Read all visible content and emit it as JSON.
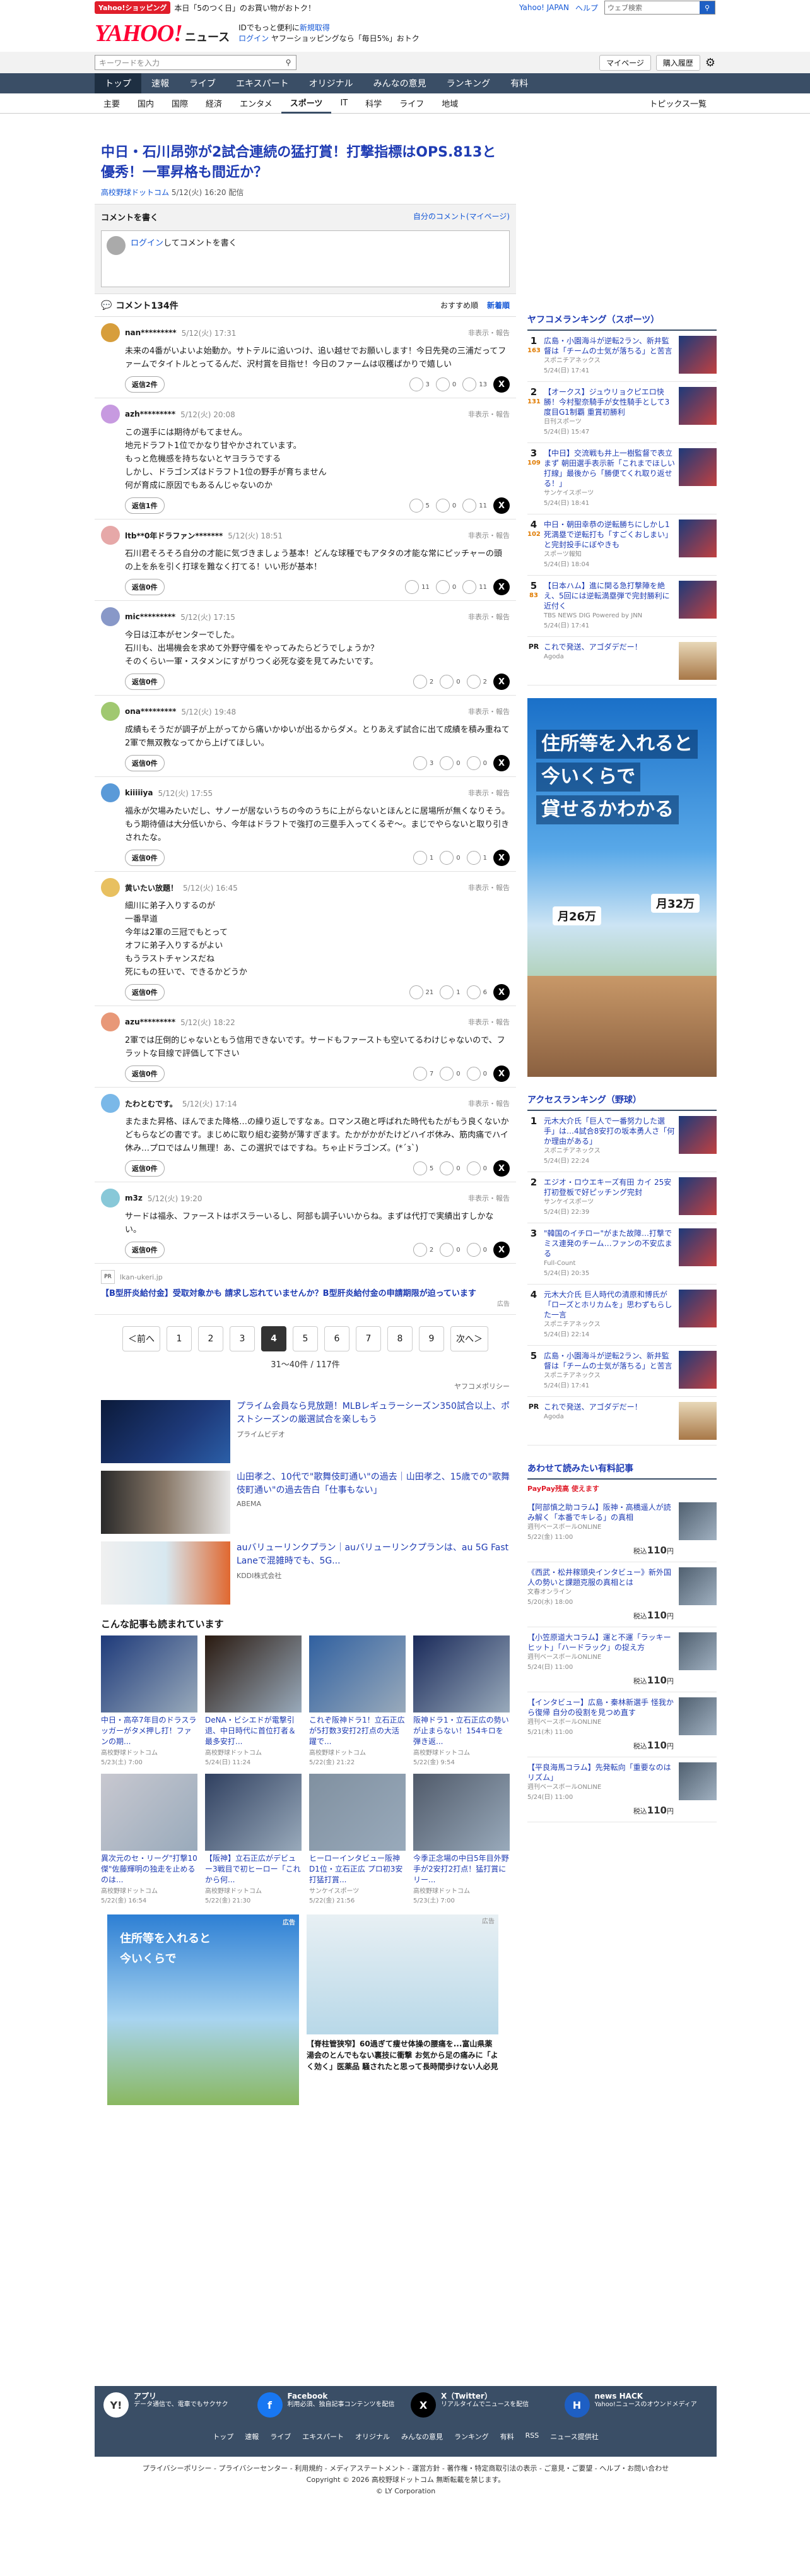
{
  "promo": {
    "badge": "Yahoo!ショッピング",
    "text": "本日「5のつく日」のお買い物がおトク！"
  },
  "topbar": {
    "links": [
      "Yahoo! JAPAN",
      "ヘルプ"
    ],
    "search_placeholder": "ウェブ検索",
    "search_label": "検索"
  },
  "header": {
    "logo": "YAHOO!",
    "logo_sub": "JAPAN",
    "service": "ニュース",
    "line1a": "IDでもっと便利に",
    "line1b": "新規取得",
    "line2a": "ログイン",
    "line2b": "ヤフーショッピングなら「毎日5%」おトク"
  },
  "search": {
    "placeholder": "キーワードを入力",
    "mypage": "マイページ",
    "purchase": "購入履歴"
  },
  "nav": [
    "トップ",
    "速報",
    "ライブ",
    "エキスパート",
    "オリジナル",
    "みんなの意見",
    "ランキング",
    "有料"
  ],
  "subnav": [
    "主要",
    "国内",
    "国際",
    "経済",
    "エンタメ",
    "スポーツ",
    "IT",
    "科学",
    "ライフ",
    "地域"
  ],
  "subnav_more": "トピックス一覧",
  "article": {
    "title": "中日・石川昂弥が2試合連続の猛打賞！打撃指標はOPS.813と優秀！一軍昇格も間近か？",
    "source": "高校野球ドットコム",
    "date": "5/12(火) 16:20",
    "status": "配信"
  },
  "comment_box": {
    "title": "コメントを書く",
    "my_comments": "自分のコメント(マイページ)",
    "login": "ログイン",
    "placeholder": "してコメントを書く"
  },
  "comment_list": {
    "title": "コメント134件",
    "sort_recommend": "おすすめ順",
    "sort_new": "新着順"
  },
  "comments": [
    {
      "user": "nan*********",
      "time": "5/12(火) 17:31",
      "report": "非表示・報告",
      "body": "未来の4番がいよいよ始動か。サトテルに追いつけ、追い越せでお願いします！今日先発の三浦だってファームでタイトルとってるんだ、沢村賞を目指せ！今日のファームは収穫ばかりで嬉しい",
      "reply": "返信2件",
      "r1": "3",
      "r2": "0",
      "r3": "13",
      "color": "#d79e3c"
    },
    {
      "user": "azh*********",
      "time": "5/12(火) 20:08",
      "report": "非表示・報告",
      "body": "この選手には期待がもてません。\n地元ドラフト1位でかなり甘やかされています。\nもっと危機感を持ちないとヤヨラうでする\nしかし、ドラゴンズはドラフト1位の野手が育ちません\n何が育成に原因でもあるんじゃないのか",
      "reply": "返信1件",
      "r1": "5",
      "r2": "0",
      "r3": "11",
      "color": "#c79ae0"
    },
    {
      "user": "ltb**0年ドラファン*******",
      "time": "5/12(火) 18:51",
      "report": "非表示・報告",
      "body": "石川君そろそろ自分の才能に気づきましょう基本！どんな球種でもアタタの才能な常にピッチャーの頭の上を糸を引く打球を難なく打てる！いい形が基本！",
      "reply": "返信0件",
      "r1": "11",
      "r2": "0",
      "r3": "11",
      "color": "#e6a8a8"
    },
    {
      "user": "mic*********",
      "time": "5/12(火) 17:15",
      "report": "非表示・報告",
      "body": "今日は江本がセンターでした。\n石川も、出場機会を求めて外野守備をやってみたらどうでしょうか？\nそのくらい一軍・スタメンにすがりつく必死な姿を見てみたいです。",
      "reply": "返信0件",
      "r1": "2",
      "r2": "0",
      "r3": "2",
      "color": "#8898c8"
    },
    {
      "user": "ona*********",
      "time": "5/12(火) 19:48",
      "report": "非表示・報告",
      "body": "成績もそうだが調子が上がってから痛いかゆいが出るからダメ。とりあえず試合に出て成績を積み重ねて2軍で無双教なってから上げてほしい。",
      "reply": "返信0件",
      "r1": "3",
      "r2": "0",
      "r3": "0",
      "color": "#a0c870"
    },
    {
      "user": "kiiiiiya",
      "time": "5/12(火) 17:55",
      "report": "非表示・報告",
      "body": "福永が欠場みたいだし、サノーが居ないうちの今のうちに上がらないとほんとに居場所が無くなりそう。\nもう期待値は大分低いから、今年はドラフトで強打の三塁手入ってくるぞ～。まじでやらないと取り引きされたな。",
      "reply": "返信0件",
      "r1": "1",
      "r2": "0",
      "r3": "1",
      "color": "#5a9ad8"
    },
    {
      "user": "黄いたい放題！",
      "time": "5/12(火) 16:45",
      "report": "非表示・報告",
      "body": "細川に弟子入りするのが\n一番早道\n今年は2軍の三冠でもとって\nオフに弟子入りするがよい\nもうラストチャンスだね\n死にもの狂いで、できるかどうか",
      "reply": "返信0件",
      "r1": "21",
      "r2": "1",
      "r3": "6",
      "color": "#e8c060"
    },
    {
      "user": "azu*********",
      "time": "5/12(火) 18:22",
      "report": "非表示・報告",
      "body": "2軍では圧倒的じゃないともう信用できないです。サードもファーストも空いてるわけじゃないので、フラットな目線で評価して下さい",
      "reply": "返信0件",
      "r1": "7",
      "r2": "0",
      "r3": "0",
      "color": "#e89878"
    },
    {
      "user": "たわとむです。",
      "time": "5/12(火) 17:14",
      "report": "非表示・報告",
      "body": "またまた昇格、ほんでまた降格…の繰り返しですなぁ。ロマンス砲と呼ばれた時代もたがもう良くないかどもらなどの書です。まじめに取り組む姿勢が薄すぎます。たかがかがたけどハイボ休み、筋肉痛でハイ休み…プロではムリ無理！あ、この選択ではですね。ちゃ止ドラゴンズ。(*´з`)",
      "reply": "返信0件",
      "r1": "5",
      "r2": "0",
      "r3": "0",
      "color": "#7ab8e8"
    },
    {
      "user": "m3z",
      "time": "5/12(火) 19:20",
      "report": "非表示・報告",
      "body": "サードは福永、ファーストはボスラーいるし、阿部も調子いいからね。まずは代打で実績出すしかない。",
      "reply": "返信0件",
      "r1": "2",
      "r2": "0",
      "r3": "0",
      "color": "#88c8d8"
    }
  ],
  "inline_ad": {
    "domain": "lkan-ukeri.jp",
    "title": "【B型肝炎給付金】受取対象かも 請求し忘れていませんか？B型肝炎給付金の申請期限が迫っています",
    "label": "広告"
  },
  "pager": {
    "prev": "＜前へ",
    "next": "次へ＞",
    "pages": [
      "1",
      "2",
      "3",
      "4",
      "5",
      "6",
      "7",
      "8",
      "9"
    ],
    "current": "4",
    "info": "31～40件 / 117件"
  },
  "policy": "ヤフコメポリシー",
  "related": [
    {
      "title": "プライム会員なら見放題！MLBレギュラーシーズン350試合以上、ポストシーズンの厳選試合を楽しもう",
      "source": "プライムビデオ"
    },
    {
      "title": "山田孝之、10代で\"歌舞伎町通い\"の過去｜山田孝之、15歳での\"歌舞伎町通い\"の過去告白「仕事もない」",
      "source": "ABEMA"
    },
    {
      "title": "auバリューリンクプラン｜auバリューリンクプランは、au 5G Fast Laneで混雑時でも、5G...",
      "source": "KDDI株式会社"
    }
  ],
  "also_read": {
    "title": "こんな記事も読まれています",
    "items": [
      {
        "title": "中日・高卒7年目のドラスラッガーがタメ押し打！ファンの期...",
        "source": "高校野球ドットコム",
        "date": "5/23(土) 7:00"
      },
      {
        "title": "DeNA・ビシエドが電撃引退、中日時代に首位打者＆最多安打...",
        "source": "高校野球ドットコム",
        "date": "5/24(日) 11:24"
      },
      {
        "title": "これぞ阪神ドラ1！立石正広が5打数3安打2打点の大活躍で...",
        "source": "高校野球ドットコム",
        "date": "5/22(金) 21:22"
      },
      {
        "title": "阪神ドラ1・立石正広の勢いが止まらない！154キロを弾き返...",
        "source": "高校野球ドットコム",
        "date": "5/22(金) 9:54"
      },
      {
        "title": "異次元のセ・リーグ\"打撃10傑\"佐藤輝明の独走を止めるのは...",
        "source": "高校野球ドットコム",
        "date": "5/22(金) 16:54"
      },
      {
        "title": "【阪神】立石正広がデビュー3戦目で初ヒーロー「これから何...",
        "source": "高校野球ドットコム",
        "date": "5/22(金) 21:30"
      },
      {
        "title": "ヒーローインタビュー阪神D1位・立石正広 プロ初3安打猛打賞...",
        "source": "サンケイスポーツ",
        "date": "5/22(金) 21:56"
      },
      {
        "title": "今季正念場の中日5年目外野手が2安打2打点！猛打賞にリー...",
        "source": "高校野球ドットコム",
        "date": "5/23(土) 7:00"
      }
    ]
  },
  "bottom_ads": [
    {
      "label": "広告"
    },
    {
      "title": "【脊柱管狭窄】60過ぎて痩せ体操の腰痛を...富山県薬湯会のとんでもない裏技に衝撃 お気から足の痛みに「よく効く」医薬品 騒されたと思って長時間歩けない人必見",
      "label": "広告"
    }
  ],
  "ranking": {
    "title": "ヤフコメランキング（スポーツ）",
    "items": [
      {
        "n": "1",
        "cnt": "163",
        "title": "広島・小園海斗が逆転2ラン、新井監督は「チームの士気が落ちる」と苦言",
        "source": "スポニチアネックス",
        "date": "5/24(日) 17:41"
      },
      {
        "n": "2",
        "cnt": "131",
        "title": "【オークス】ジュウリョクピエロ快勝！今村聖奈騎手が女性騎手として3度目G1制覇 重賞初勝利",
        "source": "日刊スポーツ",
        "date": "5/24(日) 15:47"
      },
      {
        "n": "3",
        "cnt": "109",
        "title": "【中日】交流戦も井上一樹監督で表立まず 朝田選手表示新「これまでほしい打線」最後から「勝便てくれ取り返せる！」",
        "source": "サンケイスポーツ",
        "date": "5/24(日) 18:41"
      },
      {
        "n": "4",
        "cnt": "102",
        "title": "中日・朝田幸恭の逆転勝ちにしかし1死満塁で逆転打も「すごくおしまい」と完封投手にぼやきも",
        "source": "スポーツ報知",
        "date": "5/24(日) 18:04"
      },
      {
        "n": "5",
        "cnt": "83",
        "title": "【日本ハム】進に関る急打撃陣を絶え、5回には逆転満塁弾で完封勝利に近付く",
        "source": "TBS NEWS DIG Powered by JNN",
        "date": "5/24(日) 17:41"
      }
    ]
  },
  "pr": {
    "tag": "PR",
    "title": "これで発送、アゴダデだー！",
    "source": "Agoda"
  },
  "side_ad": {
    "line1": "住所等を入れると",
    "line2": "今いくらで",
    "line3": "貸せるかわかる",
    "p1": "月26万",
    "p2": "月32万"
  },
  "access": {
    "title": "アクセスランキング（野球）",
    "items": [
      {
        "n": "1",
        "title": "元木大介氏「巨人で一番努力した選手」は…4試合8安打の坂本勇人さ「何か理由がある」",
        "source": "スポニチアネックス",
        "date": "5/24(日) 22:24"
      },
      {
        "n": "2",
        "title": "エジオ・ロウエキーズ有田 カイ 25安打初登板で好ピッチング完封",
        "source": "サンケイスポーツ",
        "date": "5/24(日) 22:39"
      },
      {
        "n": "3",
        "title": "\"韓国のイチロー\"がまた故障…打撃でミス連発のチーム…ファンの不安広まる",
        "source": "Full-Count",
        "date": "5/24(日) 20:35"
      },
      {
        "n": "4",
        "title": "元木大介氏 巨人時代の清原和博氏が「ローズとホリカムを」思わずもらした一言",
        "source": "スポニチアネックス",
        "date": "5/24(日) 22:14"
      },
      {
        "n": "5",
        "title": "広島・小園海斗が逆転2ラン、新井監督は「チームの士気が落ちる」と苦言",
        "source": "スポニチアネックス",
        "date": "5/24(日) 17:41"
      }
    ]
  },
  "goods": {
    "title": "あわせて読みたい有料記事",
    "sub": "PayPay残高 使えます",
    "items": [
      {
        "title": "【阿部慎之助コラム】阪神・高橋遥人が読み解く「本番でキレる」の真相",
        "source": "週刊ベースボールONLINE",
        "date": "5/22(金) 11:00",
        "price": "110"
      },
      {
        "title": "《西武・松井稼頭央インタビュー》新外国人の勢いと課題克服の真相とは",
        "source": "文春オンライン",
        "date": "5/20(水) 18:00",
        "price": "110"
      },
      {
        "title": "【小笠原道大コラム】運と不運「ラッキーヒット」「ハードラック」の捉え方",
        "source": "週刊ベースボールONLINE",
        "date": "5/24(日) 11:00",
        "price": "110"
      },
      {
        "title": "【インタビュー】広島・秦林新選手 怪我から復帰 自分の役割を見つめ直す",
        "source": "週刊ベースボールONLINE",
        "date": "5/21(木) 11:00",
        "price": "110"
      },
      {
        "title": "【平良海馬コラム】先発転向「重要なのはリズム」",
        "source": "週刊ベースボールONLINE",
        "date": "5/24(日) 11:00",
        "price": "110"
      }
    ]
  },
  "footer": {
    "apps": [
      {
        "name": "アプリ",
        "desc": "データ通信で、電車でもサクサク",
        "icon": "Y!"
      },
      {
        "name": "Facebook",
        "desc": "利用必須、独自記事コンテンツを配信",
        "icon": "f"
      },
      {
        "name": "X（Twitter）",
        "desc": "リアルタイムでニュースを配信",
        "icon": "X"
      },
      {
        "name": "news HACK",
        "desc": "Yahoo!ニュースのオウンドメディア",
        "icon": "H"
      }
    ],
    "nav": [
      "トップ",
      "速報",
      "ライブ",
      "エキスパート",
      "オリジナル",
      "みんなの意見",
      "ランキング",
      "有料",
      "RSS",
      "ニュース提供社"
    ]
  },
  "bottom": {
    "links": "プライバシーポリシー - プライバシーセンター - 利用規約 - メディアステートメント - 運営方針 - 著作権・特定商取引法の表示 - ご意見・ご要望 - ヘルプ・お問い合わせ",
    "copyright": "Copyright © 2026 高校野球ドットコム 無断転載を禁じます。",
    "ly": "© LY Corporation"
  }
}
